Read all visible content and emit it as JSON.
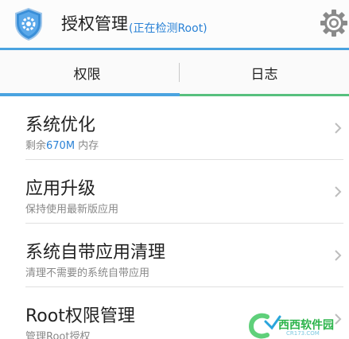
{
  "header": {
    "title": "授权管理",
    "subtitle": "(正在检测Root)",
    "app_icon": "shield-gear-icon",
    "settings_icon": "gear-icon"
  },
  "tabs": [
    {
      "label": "权限",
      "active": true
    },
    {
      "label": "日志",
      "active": false
    }
  ],
  "items": [
    {
      "title": "系统优化",
      "sub_prefix": "剩余",
      "sub_highlight": "670M",
      "sub_suffix": " 内存"
    },
    {
      "title": "应用升级",
      "subtitle": "保持使用最新版应用"
    },
    {
      "title": "系统自带应用清理",
      "subtitle": "清理不需要的系统自带应用"
    },
    {
      "title": "Root权限管理",
      "subtitle": "管理Root授权"
    }
  ],
  "watermark": {
    "text": "西西软件园",
    "url": "CR173.COM"
  },
  "colors": {
    "accent": "#4aa3e0",
    "green": "#57c07e",
    "link": "#2a82d6"
  }
}
